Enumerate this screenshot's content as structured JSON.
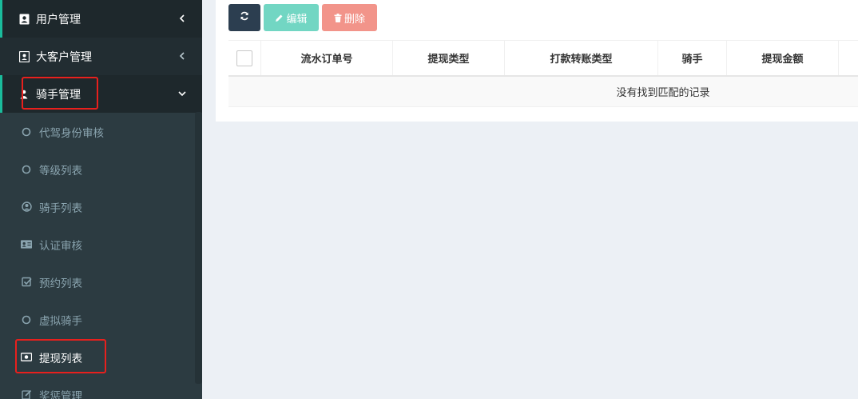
{
  "sidebar": {
    "menus": [
      {
        "label": "用户管理",
        "icon": "user-id-icon"
      },
      {
        "label": "大客户管理",
        "icon": "address-card-icon"
      },
      {
        "label": "骑手管理",
        "icon": "rider-icon"
      }
    ],
    "submenu": [
      {
        "label": "代驾身份审核",
        "icon": "circle-outline-icon"
      },
      {
        "label": "等级列表",
        "icon": "circle-outline-icon"
      },
      {
        "label": "骑手列表",
        "icon": "user-circle-icon"
      },
      {
        "label": "认证审核",
        "icon": "id-card-icon"
      },
      {
        "label": "预约列表",
        "icon": "check-square-icon"
      },
      {
        "label": "虚拟骑手",
        "icon": "circle-outline-icon"
      },
      {
        "label": "提现列表",
        "icon": "money-bill-icon"
      },
      {
        "label": "奖惩管理",
        "icon": "edit-icon"
      }
    ]
  },
  "toolbar": {
    "edit_label": "编辑",
    "delete_label": "删除"
  },
  "table": {
    "columns": [
      "流水订单号",
      "提现类型",
      "打款转账类型",
      "骑手",
      "提现金额"
    ],
    "empty_text": "没有找到匹配的记录"
  },
  "colors": {
    "sidebar_bg": "#222d32",
    "accent": "#1abc9c",
    "primary_btn": "#2c3e50",
    "edit_btn": "#72d6c3",
    "delete_btn": "#f2948a",
    "highlight": "#e8201d"
  }
}
